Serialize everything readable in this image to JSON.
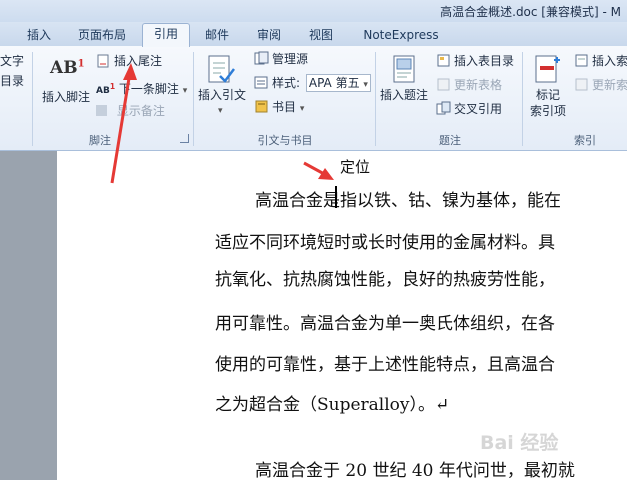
{
  "window": {
    "title": "高温合金概述.doc [兼容模式] - M"
  },
  "tabs": [
    "插入",
    "页面布局",
    "引用",
    "邮件",
    "审阅",
    "视图",
    "NoteExpress"
  ],
  "ribbon": {
    "cut_off_left": [
      "文字",
      "目录"
    ],
    "footnote_group": {
      "label": "脚注",
      "insert_footnote": "插入脚注",
      "ab_icon": "AB",
      "insert_endnote": "插入尾注",
      "next_footnote": "下一条脚注",
      "show_notes": "显示备注"
    },
    "citation_group": {
      "label": "引文与书目",
      "insert_citation": "插入引文",
      "manage_sources": "管理源",
      "style_label": "样式:",
      "style_value": "APA 第五",
      "bibliography": "书目"
    },
    "caption_group": {
      "label": "题注",
      "insert_caption": "插入题注",
      "insert_table_of_figures": "插入表目录",
      "update_table": "更新表格",
      "cross_reference": "交叉引用"
    },
    "index_group": {
      "label": "索引",
      "mark_entry": "标记\n索引项",
      "insert_index": "插入索",
      "update_index": "更新索"
    }
  },
  "annotation": {
    "label": "定位"
  },
  "document": {
    "lines": [
      "高温合金是指以铁、钴、镍为基体，能在",
      "适应不同环境短时或长时使用的金属材料。具",
      "抗氧化、抗热腐蚀性能，良好的热疲劳性能，",
      "用可靠性。高温合金为单一奥氏体组织，在各",
      "使用的可靠性，基于上述性能特点，且高温合",
      "之为超合金（Superalloy）。↵",
      "高温合金于 20 世纪 40 年代问世，最初就"
    ]
  },
  "watermark": "Bai 经验",
  "colors": {
    "arrow": "#e53935",
    "page_bg": "#ffffff",
    "doc_bg": "#9aa3ae",
    "tab_active": "#f3f7fc"
  }
}
